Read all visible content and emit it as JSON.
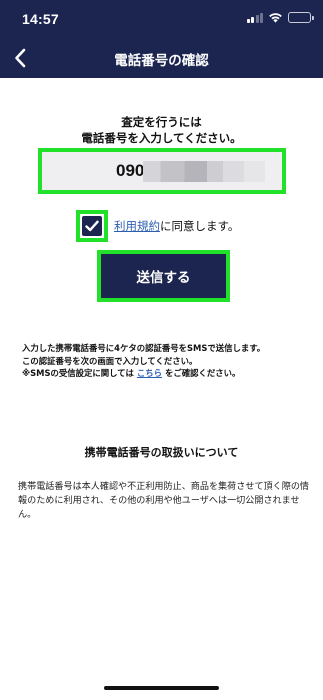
{
  "status_bar": {
    "time": "14:57",
    "icons": [
      "signal-icon",
      "wifi-icon",
      "battery-icon"
    ]
  },
  "nav": {
    "back_icon": "chevron-left-icon",
    "title": "電話番号の確認"
  },
  "intro": {
    "line1": "査定を行うには",
    "line2": "電話番号を入力してください。"
  },
  "phone": {
    "value": "090"
  },
  "agree": {
    "checked": true,
    "terms_link": "利用規約",
    "suffix": "に同意します。"
  },
  "submit": {
    "label": "送信する"
  },
  "info": {
    "line1": "入力した携帯電話番号に4ケタの認証番号をSMSで送信します。",
    "line2": "この認証番号を次の画面で入力してください。",
    "line3_prefix": "※SMSの受信設定に関しては",
    "line3_link": "こちら",
    "line3_suffix": "をご確認ください。"
  },
  "handling": {
    "heading": "携帯電話番号の取扱いについて",
    "body": "携帯電話番号は本人確認や不正利用防止、商品を集荷させて頂く際の情報のために利用され、その他の利用や他ユーザへは一切公開されません。"
  },
  "colors": {
    "navy": "#1b2550",
    "highlight_green": "#22e12a",
    "link_blue": "#2c5fb0",
    "field_gray": "#efeff1"
  }
}
